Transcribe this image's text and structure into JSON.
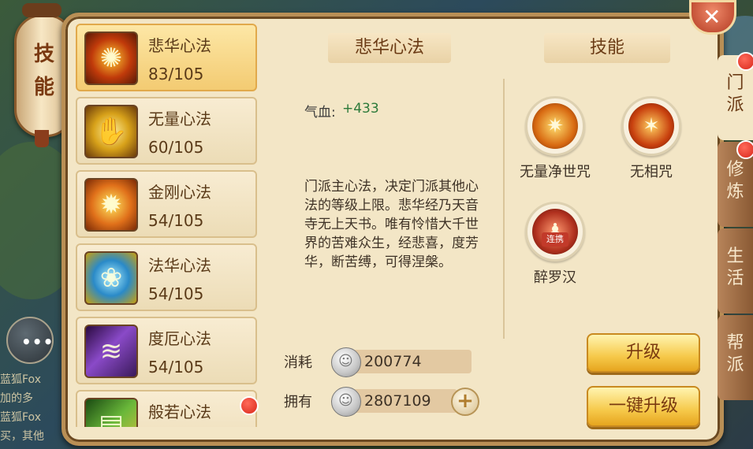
{
  "lantern": {
    "chars": [
      "技",
      "能"
    ]
  },
  "close": {
    "glyph": "✕"
  },
  "chat": {
    "lines": [
      "蓝狐Fox",
      "加的多",
      "蓝狐Fox",
      "买，其他"
    ],
    "icon_glyph": "•••"
  },
  "skill_list": [
    {
      "name": "悲华心法",
      "level": "83/105",
      "selected": true,
      "icon": "sun-burst-icon",
      "color": "#c03a0a"
    },
    {
      "name": "无量心法",
      "level": "60/105",
      "selected": false,
      "icon": "golden-hand-icon",
      "color": "#b8860b"
    },
    {
      "name": "金刚心法",
      "level": "54/105",
      "selected": false,
      "icon": "golden-wheel-icon",
      "color": "#d8701a"
    },
    {
      "name": "法华心法",
      "level": "54/105",
      "selected": false,
      "icon": "blue-lotus-icon",
      "color": "#2a8ac8"
    },
    {
      "name": "度厄心法",
      "level": "54/105",
      "selected": false,
      "icon": "purple-wave-icon",
      "color": "#5a2a88"
    },
    {
      "name": "般若心法",
      "level": "",
      "selected": false,
      "icon": "green-scroll-icon",
      "color": "#3a7a2a",
      "badge": true
    }
  ],
  "detail": {
    "title": "悲华心法",
    "stat_label": "气血:",
    "stat_value": "+433",
    "description": "门派主心法，决定门派其他心法的等级上限。悲华经乃天音寺无上天书。唯有怜惜大千世界的苦难众生，经悲喜，度芳华，断苦缚，可得涅槃。"
  },
  "skills_panel": {
    "title": "技能",
    "skills": [
      {
        "name": "无量净世咒",
        "icon": "fire-burst-icon",
        "color": "#d86a12"
      },
      {
        "name": "无相咒",
        "icon": "flame-slash-icon",
        "color": "#c8400e"
      },
      {
        "name": "醉罗汉",
        "icon": "arhat-icon",
        "color": "#b0301e",
        "tag": "连携"
      }
    ]
  },
  "cost": {
    "consume_label": "消耗",
    "consume_value": "200774",
    "own_label": "拥有",
    "own_value": "2807109",
    "plus_glyph": "+"
  },
  "buttons": {
    "upgrade": "升级",
    "upgrade_all": "一键升级"
  },
  "tabs": [
    {
      "label": "门派",
      "active": true,
      "badge": true
    },
    {
      "label": "修炼",
      "active": false,
      "badge": true
    },
    {
      "label": "生活",
      "active": false,
      "badge": false
    },
    {
      "label": "帮派",
      "active": false,
      "badge": false
    }
  ]
}
